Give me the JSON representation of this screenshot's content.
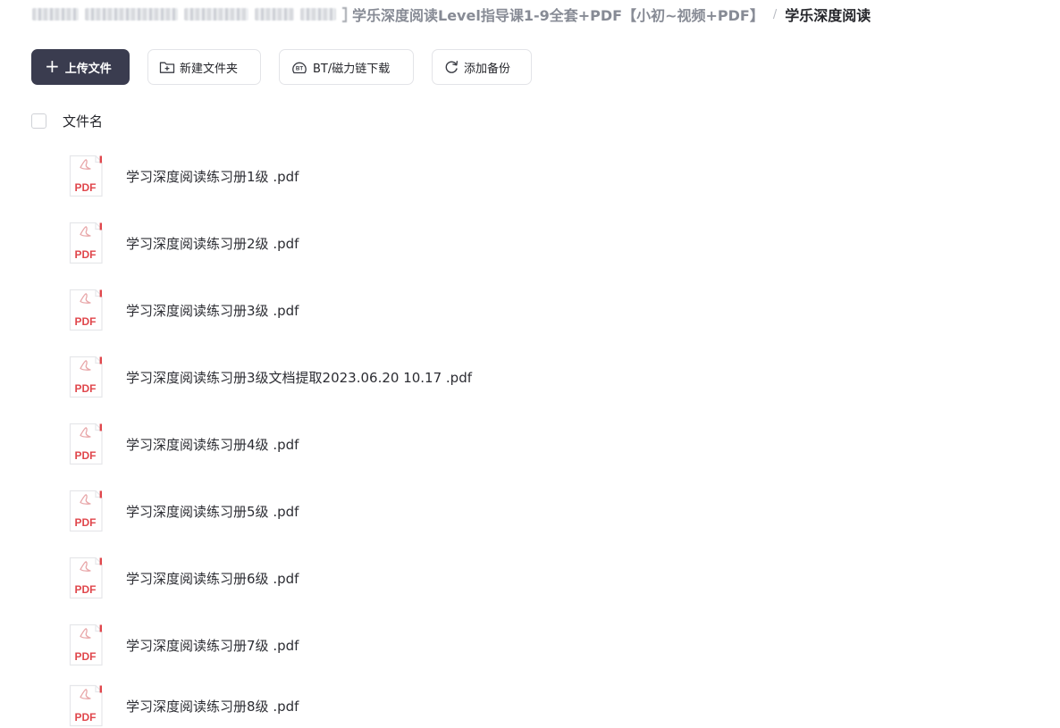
{
  "breadcrumb": {
    "parent": "学乐深度阅读Level指导课1-9全套+PDF【小初~视频+PDF】",
    "separator": "/",
    "current": "学乐深度阅读"
  },
  "toolbar": {
    "upload_label": "上传文件",
    "new_folder_label": "新建文件夹",
    "bt_download_label": "BT/磁力链下载",
    "add_backup_label": "添加备份"
  },
  "list": {
    "header_label": "文件名",
    "files": [
      {
        "name": "学习深度阅读练习册1级 .pdf",
        "icon": "pdf-file-icon"
      },
      {
        "name": "学习深度阅读练习册2级 .pdf",
        "icon": "pdf-file-icon"
      },
      {
        "name": "学习深度阅读练习册3级 .pdf",
        "icon": "pdf-file-icon"
      },
      {
        "name": "学习深度阅读练习册3级文档提取2023.06.20 10.17 .pdf",
        "icon": "pdf-file-icon"
      },
      {
        "name": "学习深度阅读练习册4级 .pdf",
        "icon": "pdf-file-icon"
      },
      {
        "name": "学习深度阅读练习册5级 .pdf",
        "icon": "pdf-file-icon"
      },
      {
        "name": "学习深度阅读练习册6级 .pdf",
        "icon": "pdf-file-icon"
      },
      {
        "name": "学习深度阅读练习册7级 .pdf",
        "icon": "pdf-file-icon"
      },
      {
        "name": "学习深度阅读练习册8级 .pdf",
        "icon": "pdf-file-icon"
      }
    ]
  },
  "icons": {
    "pdf_badge_text": "PDF",
    "bt_badge_text": "BT"
  },
  "colors": {
    "primary_button": "#3a3c4f",
    "pdf_red": "#e0474c",
    "text": "#25262b",
    "muted_breadcrumb": "#878b95"
  }
}
